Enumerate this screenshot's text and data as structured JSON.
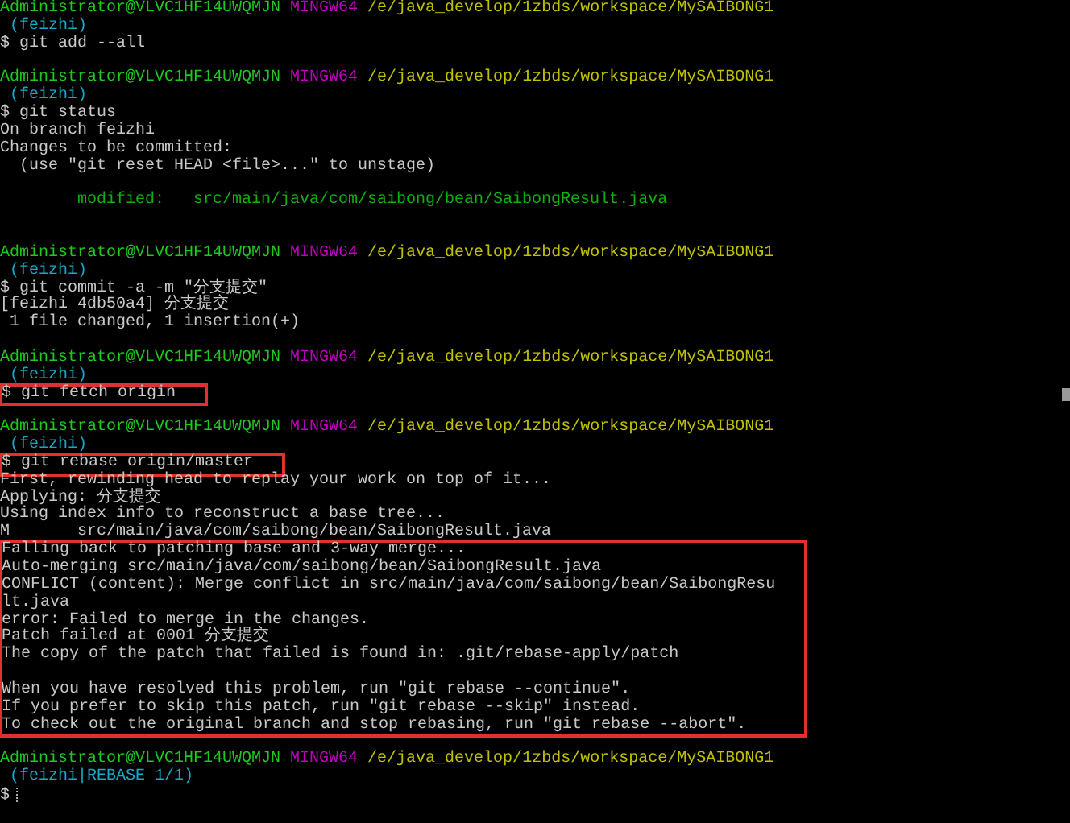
{
  "terminal": {
    "groups": [
      {
        "boxed": false,
        "lines": [
          {
            "kind": "prompt",
            "user_host": "Administrator@VLVC1HF14UWQMJN",
            "shell": "MINGW64",
            "path": "/e/java_develop/1zbds/workspace/MySAIBONG1"
          },
          {
            "kind": "branch",
            "text": " (feizhi)"
          },
          {
            "kind": "command",
            "text": "$ git add --all"
          },
          {
            "kind": "blank"
          },
          {
            "kind": "prompt",
            "user_host": "Administrator@VLVC1HF14UWQMJN",
            "shell": "MINGW64",
            "path": "/e/java_develop/1zbds/workspace/MySAIBONG1"
          },
          {
            "kind": "branch",
            "text": " (feizhi)"
          },
          {
            "kind": "command",
            "text": "$ git status"
          },
          {
            "kind": "output",
            "text": "On branch feizhi"
          },
          {
            "kind": "output",
            "text": "Changes to be committed:"
          },
          {
            "kind": "output",
            "text": "  (use \"git reset HEAD <file>...\" to unstage)"
          },
          {
            "kind": "blank"
          },
          {
            "kind": "staged",
            "text": "        modified:   src/main/java/com/saibong/bean/SaibongResult.java"
          },
          {
            "kind": "blank"
          },
          {
            "kind": "blank"
          },
          {
            "kind": "prompt",
            "user_host": "Administrator@VLVC1HF14UWQMJN",
            "shell": "MINGW64",
            "path": "/e/java_develop/1zbds/workspace/MySAIBONG1"
          },
          {
            "kind": "branch",
            "text": " (feizhi)"
          },
          {
            "kind": "command",
            "text": "$ git commit -a -m \"分支提交\""
          },
          {
            "kind": "output",
            "text": "[feizhi 4db50a4] 分支提交"
          },
          {
            "kind": "output",
            "text": " 1 file changed, 1 insertion(+)"
          },
          {
            "kind": "blank"
          },
          {
            "kind": "prompt",
            "user_host": "Administrator@VLVC1HF14UWQMJN",
            "shell": "MINGW64",
            "path": "/e/java_develop/1zbds/workspace/MySAIBONG1"
          },
          {
            "kind": "branch",
            "text": " (feizhi)"
          }
        ]
      },
      {
        "boxed": true,
        "lines": [
          {
            "kind": "command",
            "text": "$ git fetch origin"
          }
        ]
      },
      {
        "boxed": false,
        "lines": [
          {
            "kind": "blank"
          },
          {
            "kind": "prompt",
            "user_host": "Administrator@VLVC1HF14UWQMJN",
            "shell": "MINGW64",
            "path": "/e/java_develop/1zbds/workspace/MySAIBONG1"
          },
          {
            "kind": "branch",
            "text": " (feizhi)"
          }
        ]
      },
      {
        "boxed": true,
        "lines": [
          {
            "kind": "command",
            "text": "$ git rebase origin/master"
          }
        ]
      },
      {
        "boxed": false,
        "lines": [
          {
            "kind": "output",
            "text": "First, rewinding head to replay your work on top of it..."
          },
          {
            "kind": "output",
            "text": "Applying: 分支提交"
          },
          {
            "kind": "output",
            "text": "Using index info to reconstruct a base tree..."
          },
          {
            "kind": "output",
            "text": "M       src/main/java/com/saibong/bean/SaibongResult.java"
          }
        ]
      },
      {
        "boxed": true,
        "lines": [
          {
            "kind": "output",
            "text": "Falling back to patching base and 3-way merge..."
          },
          {
            "kind": "output",
            "text": "Auto-merging src/main/java/com/saibong/bean/SaibongResult.java"
          },
          {
            "kind": "output",
            "text": "CONFLICT (content): Merge conflict in src/main/java/com/saibong/bean/SaibongResu"
          },
          {
            "kind": "output",
            "text": "lt.java"
          },
          {
            "kind": "output",
            "text": "error: Failed to merge in the changes."
          },
          {
            "kind": "output",
            "text": "Patch failed at 0001 分支提交"
          },
          {
            "kind": "output",
            "text": "The copy of the patch that failed is found in: .git/rebase-apply/patch"
          },
          {
            "kind": "blank"
          },
          {
            "kind": "output",
            "text": "When you have resolved this problem, run \"git rebase --continue\"."
          },
          {
            "kind": "output",
            "text": "If you prefer to skip this patch, run \"git rebase --skip\" instead."
          },
          {
            "kind": "output",
            "text": "To check out the original branch and stop rebasing, run \"git rebase --abort\"."
          }
        ]
      },
      {
        "boxed": false,
        "lines": [
          {
            "kind": "blank"
          },
          {
            "kind": "prompt",
            "user_host": "Administrator@VLVC1HF14UWQMJN",
            "shell": "MINGW64",
            "path": "/e/java_develop/1zbds/workspace/MySAIBONG1"
          },
          {
            "kind": "branch",
            "text": " (feizhi|REBASE 1/1)"
          },
          {
            "kind": "input",
            "text": "$"
          }
        ]
      }
    ]
  }
}
